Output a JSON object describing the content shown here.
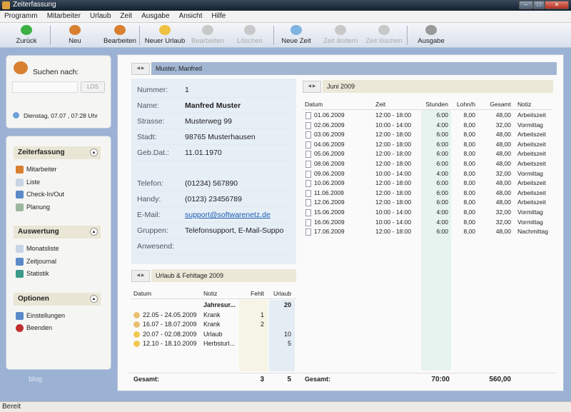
{
  "app": {
    "title": "Zeiterfassung"
  },
  "menu": [
    "Programm",
    "Mitarbeiter",
    "Urlaub",
    "Zeit",
    "Ausgabe",
    "Ansicht",
    "Hilfe"
  ],
  "toolbar": [
    {
      "label": "Zurück",
      "icon": "back-arrow-icon",
      "enabled": true,
      "color": "#3cb043"
    },
    {
      "label": "Neu",
      "icon": "new-user-icon",
      "enabled": true,
      "color": "#d98030"
    },
    {
      "label": "Bearbeiten",
      "icon": "edit-user-icon",
      "enabled": true,
      "color": "#d98030"
    },
    {
      "label": "Neuer Urlaub",
      "icon": "sun-icon",
      "enabled": true,
      "color": "#f0c040"
    },
    {
      "label": "Bearbeiten",
      "icon": "edit-vacation-icon",
      "enabled": false,
      "color": "#c8c8c8"
    },
    {
      "label": "Löschen",
      "icon": "delete-vacation-icon",
      "enabled": false,
      "color": "#c8c8c8"
    },
    {
      "label": "Neue Zeit",
      "icon": "clock-icon",
      "enabled": true,
      "color": "#7fb3e0"
    },
    {
      "label": "Zeit ändern",
      "icon": "edit-time-icon",
      "enabled": false,
      "color": "#c8c8c8"
    },
    {
      "label": "Zeit löschen",
      "icon": "delete-time-icon",
      "enabled": false,
      "color": "#c8c8c8"
    },
    {
      "label": "Ausgabe",
      "icon": "printer-icon",
      "enabled": true,
      "color": "#999"
    }
  ],
  "search": {
    "label": "Suchen nach:",
    "value": "",
    "button": "LOS",
    "datetime": "Dienstag, 07.07 , 07:28 Uhr"
  },
  "nav": [
    {
      "title": "Zeiterfassung",
      "items": [
        "Mitarbeiter",
        "Liste",
        "Check-In/Out",
        "Planung"
      ]
    },
    {
      "title": "Auswertung",
      "items": [
        "Monatsliste",
        "Zeitjournal",
        "Statistik"
      ]
    },
    {
      "title": "Optionen",
      "items": [
        "Einstellungen",
        "Beenden"
      ]
    }
  ],
  "blog": "blog",
  "employee": {
    "header": "Muster, Manfred",
    "fields": [
      {
        "label": "Nummer:",
        "value": "1"
      },
      {
        "label": "Name:",
        "value": "Manfred Muster"
      },
      {
        "label": "Strasse:",
        "value": "Musterweg 99"
      },
      {
        "label": "Stadt:",
        "value": "98765 Musterhausen"
      },
      {
        "label": "Geb.Dat.:",
        "value": "11.01.1970"
      },
      {
        "label": "Telefon:",
        "value": "(01234) 567890"
      },
      {
        "label": "Handy:",
        "value": "(0123) 23456789"
      },
      {
        "label": "E-Mail:",
        "value": "support@softwarenetz.de"
      },
      {
        "label": "Gruppen:",
        "value": "Telefonsupport, E-Mail-Suppo"
      },
      {
        "label": "Anwesend:",
        "value": ""
      }
    ]
  },
  "vacation": {
    "header": "Urlaub & Fehltage 2009",
    "columns": [
      "Datum",
      "Notiz",
      "Fehlt",
      "Urlaub"
    ],
    "rows": [
      {
        "datum": "",
        "notiz": "Jahresur...",
        "fehlt": "",
        "urlaub": "20",
        "bold": true
      },
      {
        "datum": "22.05 - 24.05.2009",
        "notiz": "Krank",
        "fehlt": "1",
        "urlaub": "",
        "icon": "sick-icon"
      },
      {
        "datum": "16.07 - 18.07.2009",
        "notiz": "Krank",
        "fehlt": "2",
        "urlaub": "",
        "icon": "sick-icon"
      },
      {
        "datum": "20.07 - 02.08.2009",
        "notiz": "Urlaub",
        "fehlt": "",
        "urlaub": "10",
        "icon": "sun-icon"
      },
      {
        "datum": "12.10 - 18.10.2009",
        "notiz": "Herbsturl...",
        "fehlt": "",
        "urlaub": "5",
        "icon": "sun-icon"
      }
    ],
    "total_label": "Gesamt:",
    "total_fehlt": "3",
    "total_urlaub": "5"
  },
  "times": {
    "header": "Juni 2009",
    "columns": [
      "Datum",
      "Zeit",
      "Stunden",
      "Lohn/h",
      "Gesamt",
      "Notiz"
    ],
    "rows": [
      [
        "01.06.2009",
        "12:00 - 18:00",
        "6:00",
        "8,00",
        "48,00",
        "Arbeitszeit"
      ],
      [
        "02.06.2009",
        "10:00 - 14:00",
        "4:00",
        "8,00",
        "32,00",
        "Vormittag"
      ],
      [
        "03.06.2009",
        "12:00 - 18:00",
        "6:00",
        "8,00",
        "48,00",
        "Arbeitszeit"
      ],
      [
        "04.06.2009",
        "12:00 - 18:00",
        "6:00",
        "8,00",
        "48,00",
        "Arbeitszeit"
      ],
      [
        "05.06.2009",
        "12:00 - 18:00",
        "6:00",
        "8,00",
        "48,00",
        "Arbeitszeit"
      ],
      [
        "08.06.2009",
        "12:00 - 18:00",
        "6:00",
        "8,00",
        "48,00",
        "Arbeitszeit"
      ],
      [
        "09.06.2009",
        "10:00 - 14:00",
        "4:00",
        "8,00",
        "32,00",
        "Vormittag"
      ],
      [
        "10.06.2009",
        "12:00 - 18:00",
        "6:00",
        "8,00",
        "48,00",
        "Arbeitszeit"
      ],
      [
        "11.06.2009",
        "12:00 - 18:00",
        "6:00",
        "8,00",
        "48,00",
        "Arbeitszeit"
      ],
      [
        "12.06.2009",
        "12:00 - 18:00",
        "6:00",
        "8,00",
        "48,00",
        "Arbeitszeit"
      ],
      [
        "15.06.2009",
        "10:00 - 14:00",
        "4:00",
        "8,00",
        "32,00",
        "Vormittag"
      ],
      [
        "16.06.2009",
        "10:00 - 14:00",
        "4:00",
        "8,00",
        "32,00",
        "Vormittag"
      ],
      [
        "17.06.2009",
        "12:00 - 18:00",
        "6:00",
        "8,00",
        "48,00",
        "Nachmittag"
      ]
    ],
    "total_label": "Gesamt:",
    "total_stunden": "70:00",
    "total_gesamt": "560,00"
  },
  "status": "Bereit"
}
